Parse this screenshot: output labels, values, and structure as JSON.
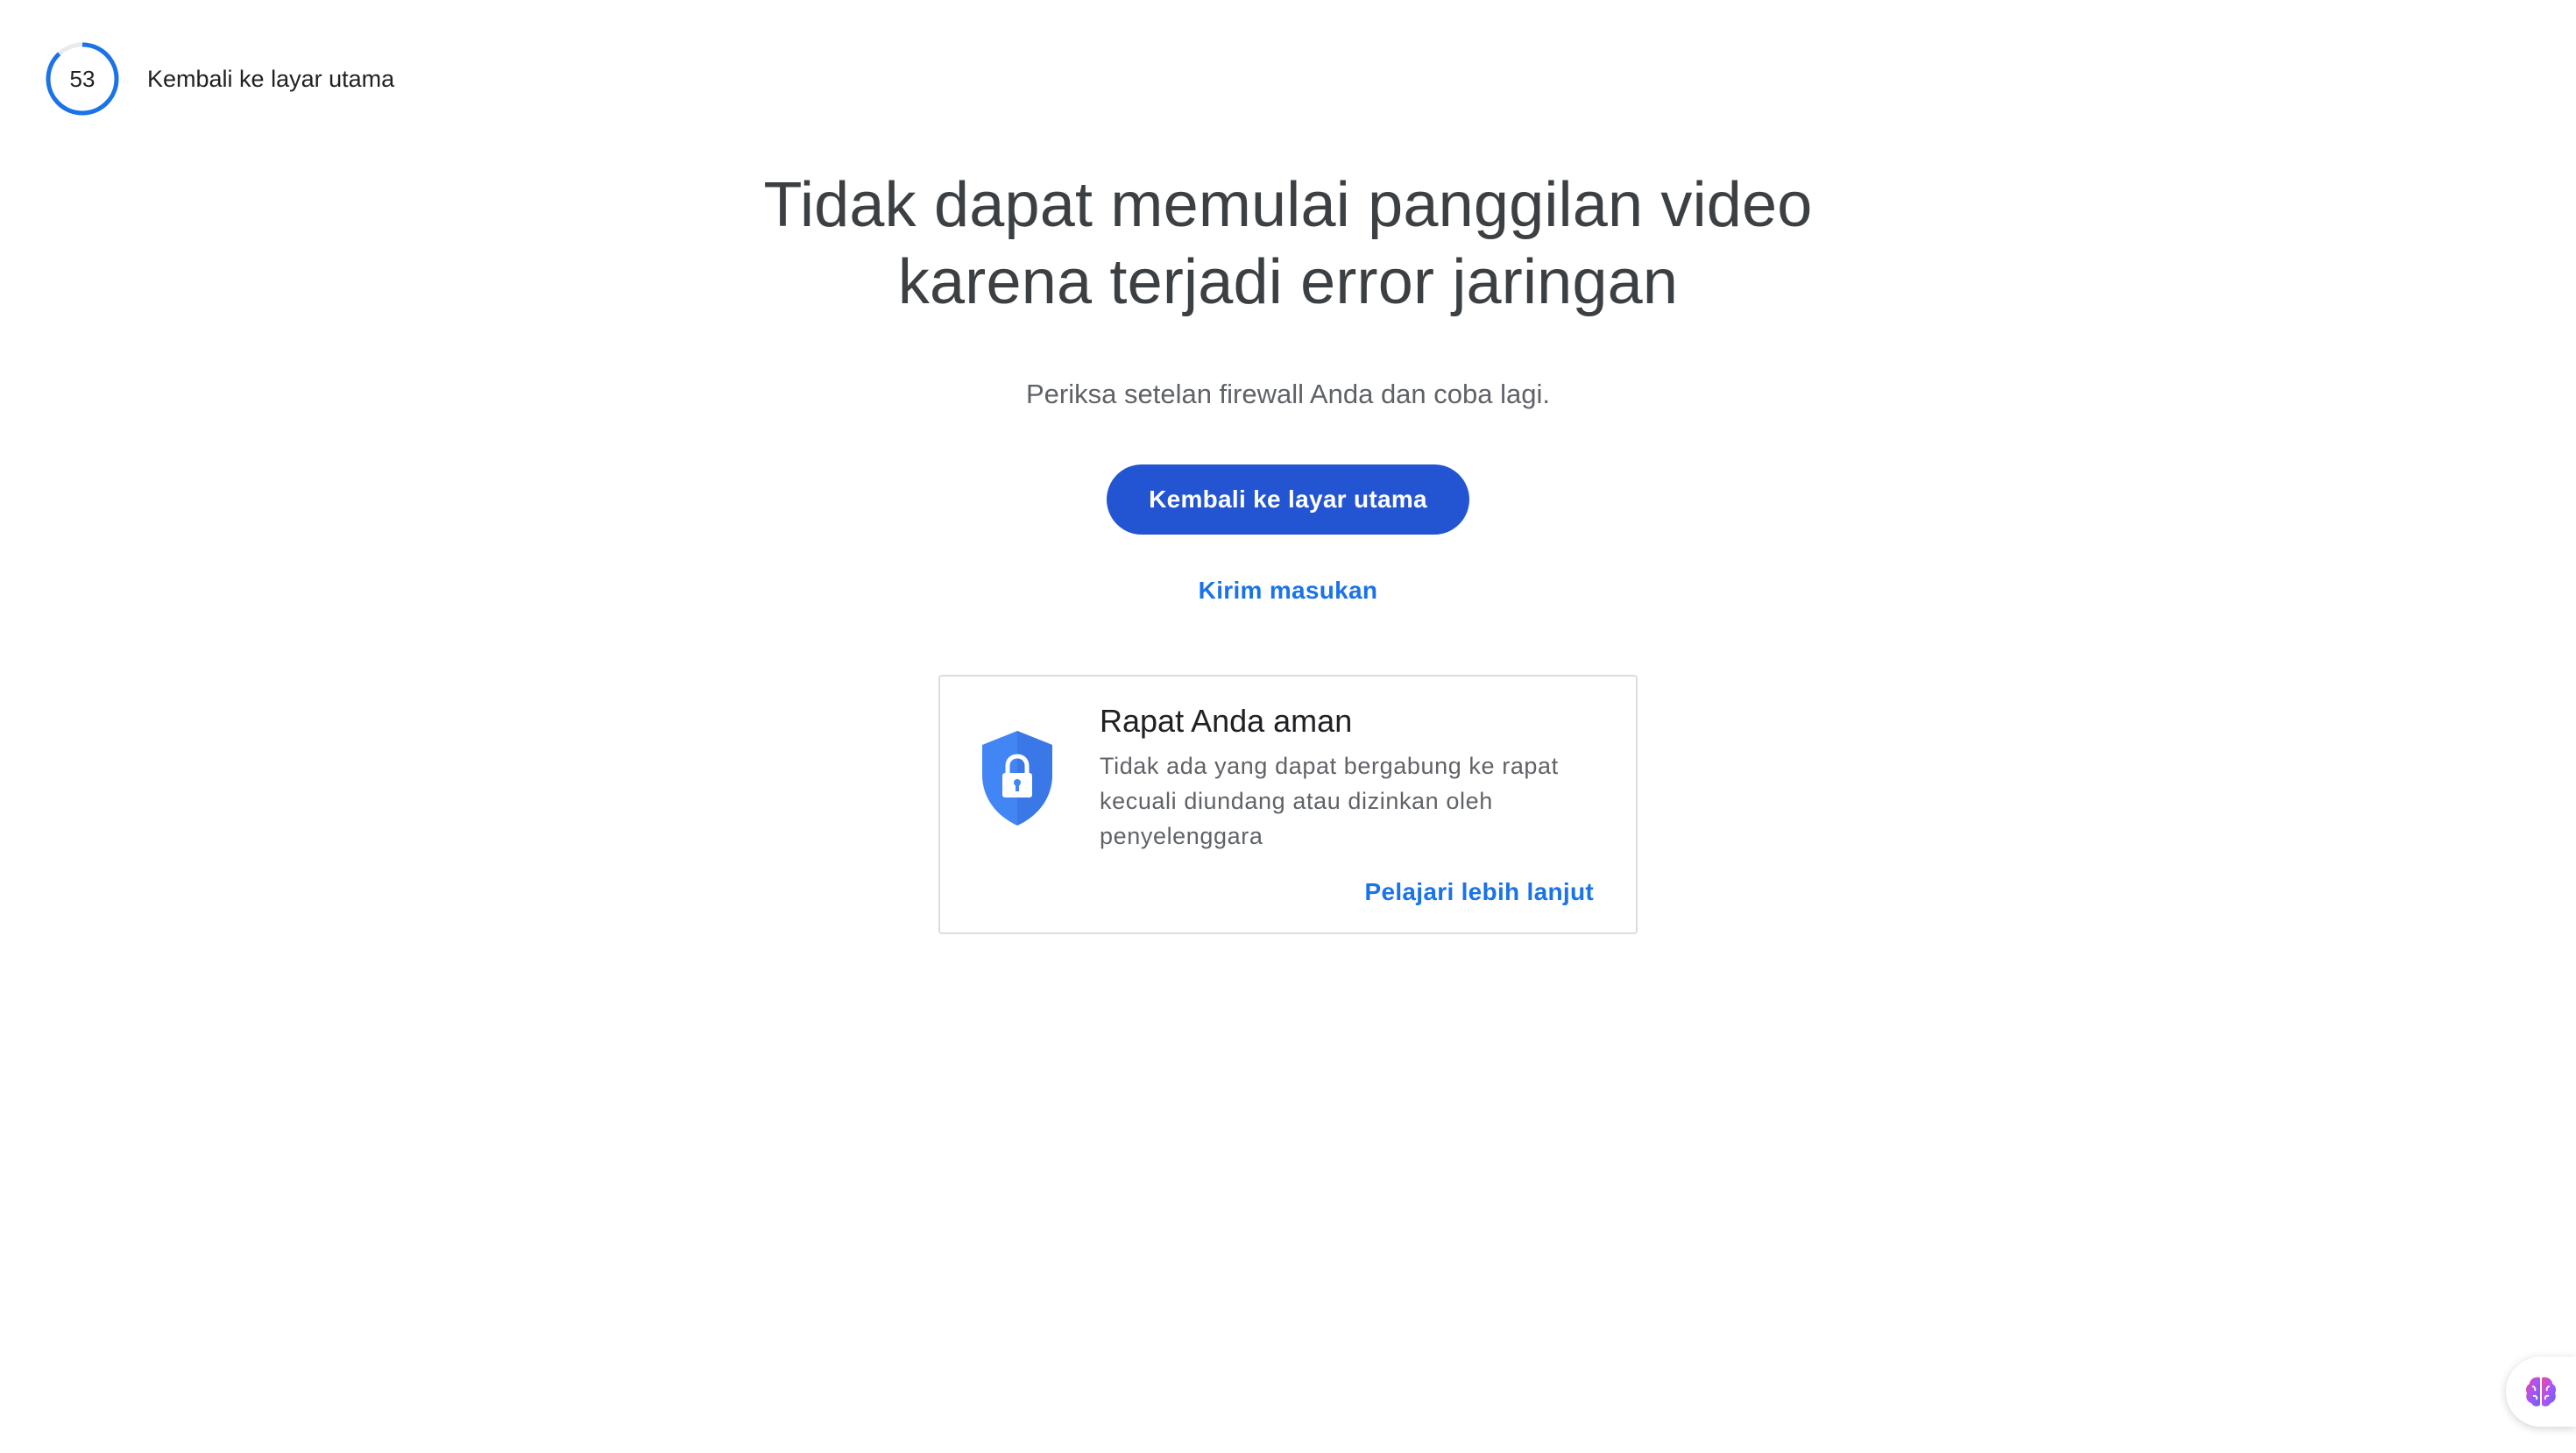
{
  "header": {
    "countdown": "53",
    "countdown_progress": 0.88,
    "return_label": "Kembali ke layar utama"
  },
  "main": {
    "headline_line1": "Tidak dapat memulai panggilan video",
    "headline_line2": "karena terjadi error jaringan",
    "subtext": "Periksa setelan firewall Anda dan coba lagi.",
    "primary_button_label": "Kembali ke layar utama",
    "feedback_link_label": "Kirim masukan"
  },
  "security_card": {
    "title": "Rapat Anda aman",
    "body": "Tidak ada yang dapat bergabung ke rapat kecuali diundang atau dizinkan oleh penyelenggara",
    "link_label": "Pelajari lebih lanjut",
    "icon": "shield-lock-icon"
  },
  "corner_badge": {
    "icon": "brain-icon"
  },
  "colors": {
    "accent_blue": "#1a73e8",
    "button_blue": "#2355d2",
    "shield_blue": "#4285f4",
    "text_primary": "#3c4043",
    "text_secondary": "#5f6368",
    "card_border": "#dadce0"
  }
}
